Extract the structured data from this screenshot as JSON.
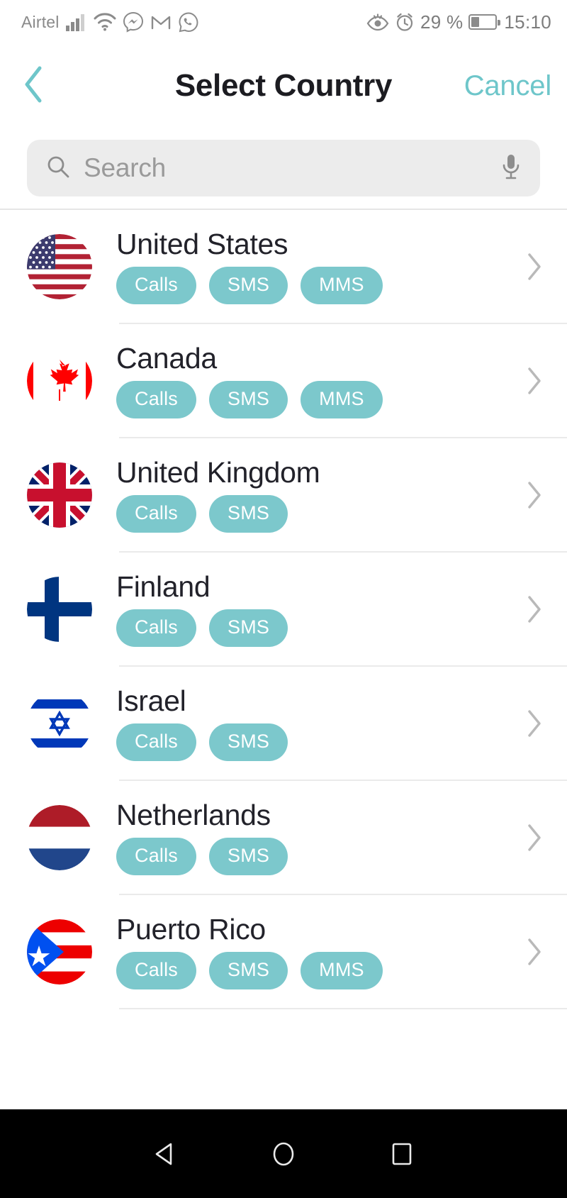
{
  "statusbar": {
    "carrier": "Airtel",
    "left_icons": [
      "signal-bars-icon",
      "wifi-icon",
      "messenger-icon",
      "gmail-icon",
      "whatsapp-icon"
    ],
    "right_icons": [
      "eye-comfort-icon",
      "alarm-clock-icon"
    ],
    "battery_percent": "29 %",
    "battery_level": 29,
    "time": "15:10"
  },
  "header": {
    "back_icon": "chevron-left-icon",
    "title": "Select Country",
    "cancel_label": "Cancel"
  },
  "search": {
    "icon": "search-icon",
    "placeholder": "Search",
    "value": "",
    "mic_icon": "microphone-icon"
  },
  "colors": {
    "accent": "#6ec6ca",
    "badge": "#7cc8cc",
    "title": "#1c1c21",
    "search_bg": "#ececec",
    "divider": "#eaeaea",
    "navbar_bg": "#000000"
  },
  "list": {
    "chevron_icon": "chevron-right-icon",
    "items": [
      {
        "name": "United States",
        "flag": "flag-us",
        "badges": [
          "Calls",
          "SMS",
          "MMS"
        ]
      },
      {
        "name": "Canada",
        "flag": "flag-ca",
        "badges": [
          "Calls",
          "SMS",
          "MMS"
        ]
      },
      {
        "name": "United Kingdom",
        "flag": "flag-gb",
        "badges": [
          "Calls",
          "SMS"
        ]
      },
      {
        "name": "Finland",
        "flag": "flag-fi",
        "badges": [
          "Calls",
          "SMS"
        ]
      },
      {
        "name": "Israel",
        "flag": "flag-il",
        "badges": [
          "Calls",
          "SMS"
        ]
      },
      {
        "name": "Netherlands",
        "flag": "flag-nl",
        "badges": [
          "Calls",
          "SMS"
        ]
      },
      {
        "name": "Puerto Rico",
        "flag": "flag-pr",
        "badges": [
          "Calls",
          "SMS",
          "MMS"
        ]
      }
    ]
  },
  "navbar": {
    "buttons": [
      "back-triangle-icon",
      "home-circle-icon",
      "recents-square-icon"
    ]
  }
}
